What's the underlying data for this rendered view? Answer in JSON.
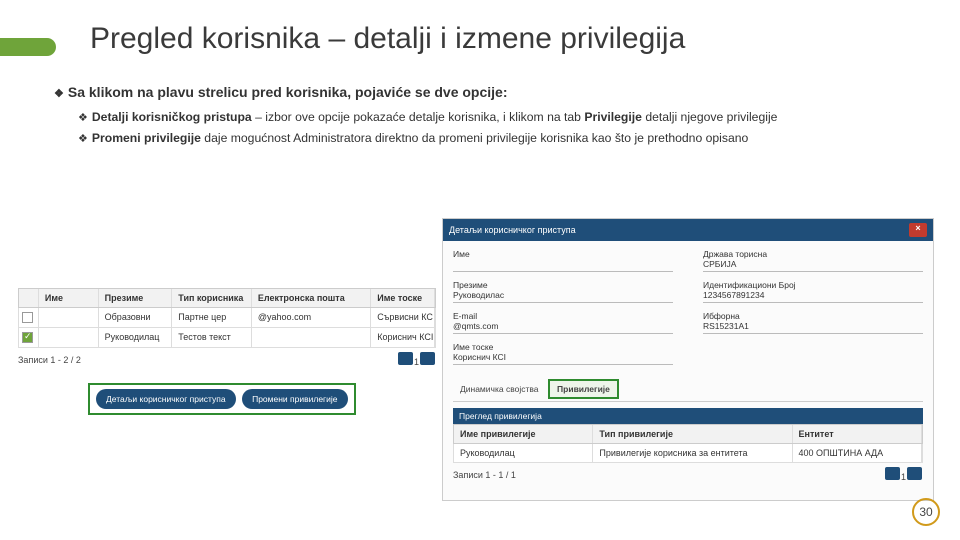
{
  "title": "Pregled korisnika – detalji i izmene privilegija",
  "lead": "Sa klikom na plavu strelicu pred korisnika, pojaviće se dve opcije:",
  "bul1_b": "Detalji korisničkog pristupa",
  "bul1_r": " – izbor ove opcije pokazaće detalje korisnika, i klikom na tab ",
  "bul1_b2": "Privilegije",
  "bul1_r2": " detalji njegove privilegije",
  "bul2_b": "Promeni privilegije",
  "bul2_r": " daje mogućnost Administratora direktno da promeni privilegije korisnika kao što je prethodno opisano",
  "left": {
    "h1": "",
    "h2": "Име",
    "h3": "Презиме",
    "h4": "Тип корисника",
    "h5": "Електронска пошта",
    "h6": "Име тоске",
    "r1": {
      "c3": "Образовни",
      "c4": "Партне цер",
      "c5": "@yahoo.com",
      "c6": "Сървисни КС"
    },
    "r2": {
      "c3": "Руководилац",
      "c4": "Тестов текст",
      "c5": "",
      "c6": "Кориснич КСI"
    },
    "pager": "Записи 1 - 2 / 2",
    "btn1": "Детаљи корисничког приступа",
    "btn2": "Промени привилегије"
  },
  "right": {
    "title": "Детаљи корисничког приступа",
    "f1": "Име",
    "f2": "Презиме",
    "v2": "Руководилас",
    "f3": "Е-mail",
    "v3": "@qmts.com",
    "f4": "Име тоске",
    "v4": "Кориснич КСI",
    "g1": "Држава торисна",
    "gv1": "СРБИЈА",
    "g2": "Идентификациони Број",
    "gv2": "1234567891234",
    "g3": "Ибфорна",
    "gv3": "RS15231A1",
    "tab1": "Динамичка својства",
    "tab2": "Привилегије",
    "sub": "Преглед привилегија",
    "th1": "Име привилегије",
    "th2": "Тип привилегије",
    "th3": "Ентитет",
    "td1": "Руководилац",
    "td2": "Привилегије корисника за ентитета",
    "td3": "400 ОПШТИНА АДА",
    "pager": "Записи 1 - 1 / 1"
  },
  "page": "30"
}
